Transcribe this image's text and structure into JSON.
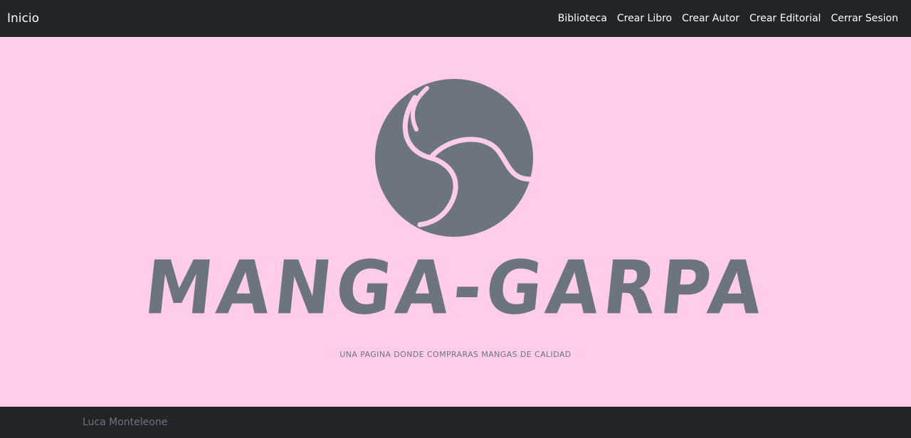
{
  "navbar": {
    "brand": "Inicio",
    "links": [
      {
        "label": "Biblioteca"
      },
      {
        "label": "Crear Libro"
      },
      {
        "label": "Crear Autor"
      },
      {
        "label": "Crear Editorial"
      },
      {
        "label": "Cerrar Sesion"
      }
    ]
  },
  "hero": {
    "background_color": "#ffcceb",
    "logo_color": "#6c757d",
    "logo_icon": "tomoe-swirl-icon",
    "title": "MANGA-GARPA",
    "tagline": "UNA PAGINA DONDE COMPRARAS MANGAS DE CALIDAD"
  },
  "footer": {
    "author": "Luca Monteleone"
  }
}
